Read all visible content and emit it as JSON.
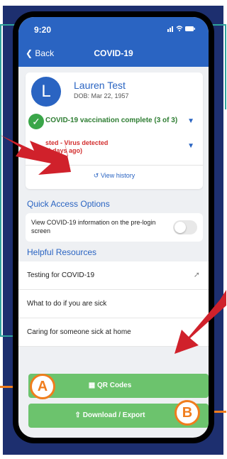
{
  "status": {
    "time": "9:20",
    "icons": "signal wifi battery"
  },
  "nav": {
    "back_label": "Back",
    "title": "COVID-19"
  },
  "profile": {
    "initial": "L",
    "name": "Lauren Test",
    "dob": "DOB: Mar 22, 1957",
    "vaccination_status": "COVID-19 vaccination complete (3 of 3)",
    "test_status_line1": "sted - Virus detected",
    "test_status_line2": ",4 days ago)",
    "view_history_label": "View history"
  },
  "quick_access": {
    "title": "Quick Access Options",
    "option_label": "View COVID-19 information on the pre-login screen",
    "toggle_on": false
  },
  "resources": {
    "title": "Helpful Resources",
    "items": [
      {
        "label": "Testing for COVID-19"
      },
      {
        "label": "What to do if you are sick"
      },
      {
        "label": "Caring for someone sick at home"
      }
    ]
  },
  "actions": {
    "qr_label": "QR Codes",
    "download_label": "Download / Export"
  },
  "callouts": {
    "a": "A",
    "b": "B"
  },
  "colors": {
    "primary": "#2a64c2",
    "success": "#3aa649",
    "danger": "#d32f2f",
    "button_green": "#6cc36d",
    "callout_orange": "#f07d1d",
    "frame_navy": "#1d2f6f",
    "arrow_red": "#d0212b"
  }
}
